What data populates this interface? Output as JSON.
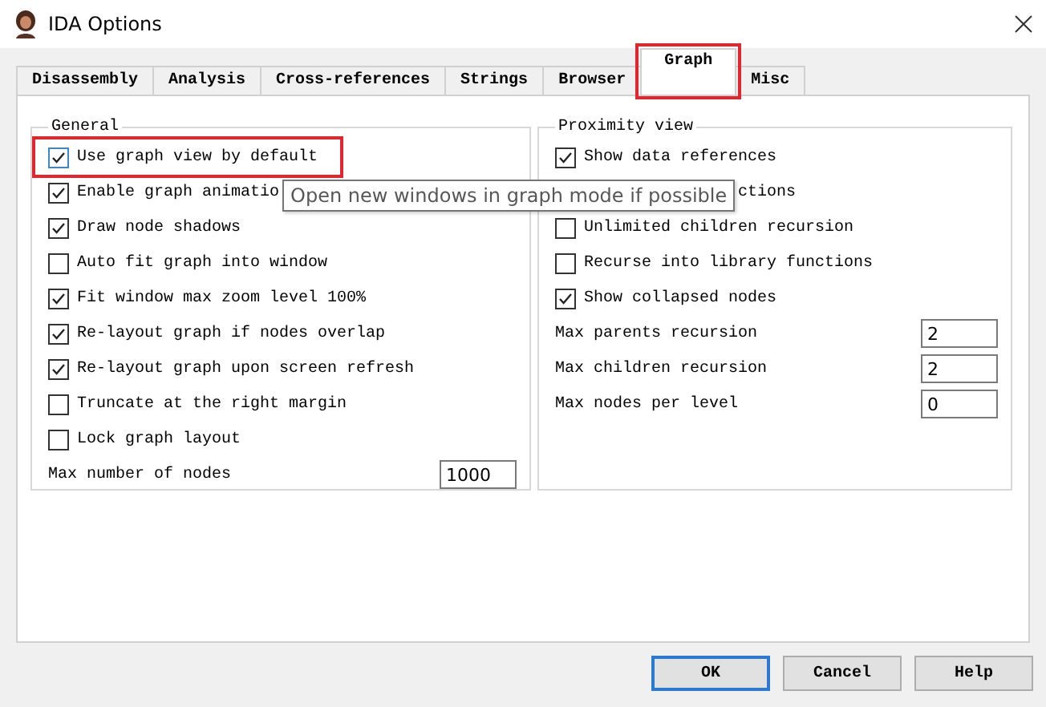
{
  "window": {
    "title": "IDA Options"
  },
  "tabs": [
    {
      "label": "Disassembly",
      "selected": false,
      "highlighted": false
    },
    {
      "label": "Analysis",
      "selected": false,
      "highlighted": false
    },
    {
      "label": "Cross-references",
      "selected": false,
      "highlighted": false
    },
    {
      "label": "Strings",
      "selected": false,
      "highlighted": false
    },
    {
      "label": "Browser",
      "selected": false,
      "highlighted": false
    },
    {
      "label": "Graph",
      "selected": true,
      "highlighted": true
    },
    {
      "label": "Misc",
      "selected": false,
      "highlighted": false
    }
  ],
  "general": {
    "title": "General",
    "options": [
      {
        "kind": "check",
        "label": "Use graph view by default",
        "checked": true,
        "highlighted": true
      },
      {
        "kind": "check",
        "label": "Enable graph animatio",
        "checked": true,
        "highlighted": false
      },
      {
        "kind": "check",
        "label": "Draw node shadows",
        "checked": true,
        "highlighted": false
      },
      {
        "kind": "check",
        "label": "Auto fit graph into window",
        "checked": false,
        "highlighted": false
      },
      {
        "kind": "check",
        "label": "Fit window max zoom level 100%",
        "checked": true,
        "highlighted": false
      },
      {
        "kind": "check",
        "label": "Re-layout graph if nodes overlap",
        "checked": true,
        "highlighted": false
      },
      {
        "kind": "check",
        "label": "Re-layout graph upon screen refresh",
        "checked": true,
        "highlighted": false
      },
      {
        "kind": "check",
        "label": "Truncate at the right margin",
        "checked": false,
        "highlighted": false
      },
      {
        "kind": "check",
        "label": "Lock graph layout",
        "checked": false,
        "highlighted": false
      },
      {
        "kind": "number",
        "label": "Max number of nodes",
        "value": "1000"
      }
    ]
  },
  "proximity": {
    "title": "Proximity view",
    "options": [
      {
        "kind": "check",
        "label": "Show data references",
        "checked": true
      },
      {
        "kind": "covered",
        "label": "ctions"
      },
      {
        "kind": "check",
        "label": "Unlimited children recursion",
        "checked": false
      },
      {
        "kind": "check",
        "label": "Recurse into library functions",
        "checked": false
      },
      {
        "kind": "check",
        "label": "Show collapsed nodes",
        "checked": true
      },
      {
        "kind": "number",
        "label": "Max parents recursion",
        "value": "2"
      },
      {
        "kind": "number",
        "label": "Max children recursion",
        "value": "2"
      },
      {
        "kind": "number",
        "label": "Max nodes per level",
        "value": "0"
      }
    ]
  },
  "tooltip": "Open new windows in graph mode if possible",
  "buttons": [
    {
      "label": "OK",
      "default": true
    },
    {
      "label": "Cancel",
      "default": false
    },
    {
      "label": "Help",
      "default": false
    }
  ]
}
